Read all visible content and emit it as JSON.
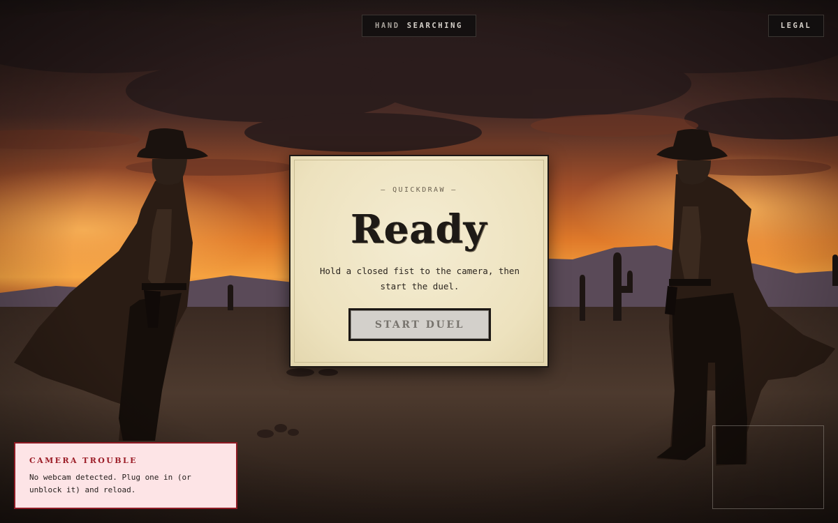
{
  "hud": {
    "hand_label": "HAND",
    "hand_status": "SEARCHING",
    "legal_label": "LEGAL"
  },
  "dialog": {
    "kicker": "— QUICKDRAW —",
    "title": "Ready",
    "message": "Hold a closed fist to the camera, then start the duel.",
    "start_label": "START DUEL"
  },
  "camera_error": {
    "title": "CAMERA TROUBLE",
    "message": "No webcam detected. Plug one in (or unblock it) and reload."
  },
  "colors": {
    "sky_top": "#2a1d1c",
    "sunset": "#f08a2c",
    "parchment": "#efe5c3",
    "error_red": "#9b1c26"
  }
}
